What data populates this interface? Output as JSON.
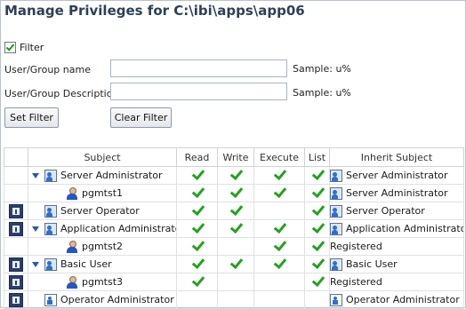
{
  "title": "Manage Privileges for C:\\ibi\\apps\\app06",
  "filter": {
    "label": "Filter",
    "checked": true,
    "user_group_name_label": "User/Group name",
    "user_group_name_value": "",
    "user_group_desc_label": "User/Group Description",
    "user_group_desc_value": "",
    "sample1": "Sample: u%",
    "sample2": "Sample: u%",
    "set_filter": "Set Filter",
    "clear_filter": "Clear Filter"
  },
  "grid": {
    "headers": [
      "Subject",
      "Read",
      "Write",
      "Execute",
      "List",
      "Inherit Subject"
    ],
    "rows": [
      {
        "subject": "Server Administrator",
        "type": "group",
        "expanded": true,
        "indent": 0,
        "edit": false,
        "read": true,
        "write": true,
        "execute": true,
        "list": true,
        "inherit_icon": "group",
        "inherit": "Server Administrator"
      },
      {
        "subject": "pgmtst1",
        "type": "user",
        "expanded": false,
        "indent": 1,
        "edit": false,
        "read": true,
        "write": true,
        "execute": true,
        "list": true,
        "inherit_icon": "group",
        "inherit": "Server Administrator"
      },
      {
        "subject": "Server Operator",
        "type": "group",
        "expanded": false,
        "indent": 0,
        "edit": true,
        "read": true,
        "write": true,
        "execute": false,
        "list": true,
        "inherit_icon": "group",
        "inherit": "Server Operator"
      },
      {
        "subject": "Application Administrator",
        "type": "group",
        "expanded": true,
        "indent": 0,
        "edit": true,
        "read": true,
        "write": true,
        "execute": true,
        "list": true,
        "inherit_icon": "group",
        "inherit": "Application Administrator"
      },
      {
        "subject": "pgmtst2",
        "type": "user",
        "expanded": false,
        "indent": 1,
        "edit": false,
        "read": true,
        "write": false,
        "execute": true,
        "list": true,
        "inherit_icon": "none",
        "inherit": "Registered"
      },
      {
        "subject": "Basic User",
        "type": "group",
        "expanded": true,
        "indent": 0,
        "edit": true,
        "read": true,
        "write": true,
        "execute": true,
        "list": true,
        "inherit_icon": "group",
        "inherit": "Basic User"
      },
      {
        "subject": "pgmtst3",
        "type": "user",
        "expanded": false,
        "indent": 1,
        "edit": true,
        "read": true,
        "write": false,
        "execute": false,
        "list": true,
        "inherit_icon": "none",
        "inherit": "Registered"
      },
      {
        "subject": "Operator Administrator",
        "type": "role",
        "expanded": false,
        "indent": 0,
        "edit": true,
        "read": false,
        "write": false,
        "execute": false,
        "list": false,
        "inherit_icon": "role",
        "inherit": "Operator Administrator"
      }
    ]
  }
}
